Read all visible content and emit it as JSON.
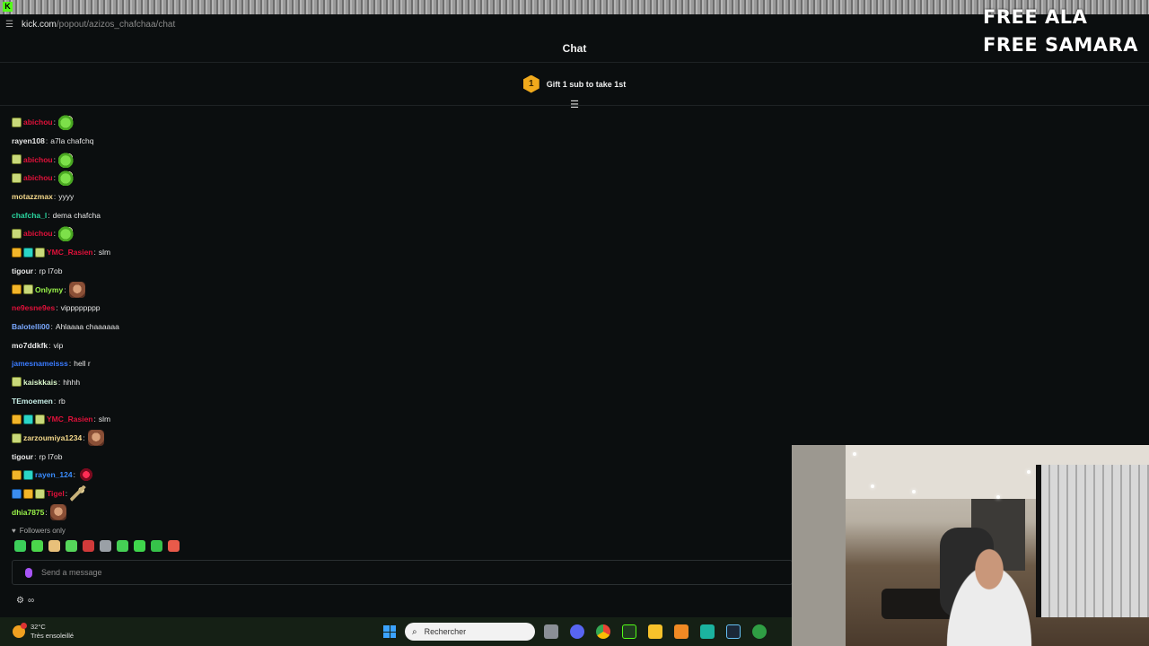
{
  "browser": {
    "url_host": "kick.com",
    "url_path": "/popout/azizos_chafchaa/chat"
  },
  "overlay": {
    "line1": "FREE ALA",
    "line2": "FREE SAMARA"
  },
  "chat": {
    "title": "Chat",
    "gift_rank": "1",
    "gift_text": "Gift 1 sub to take 1st",
    "followers_only": "Followers only",
    "input_placeholder": "Send a message",
    "messages": [
      {
        "badges": [
          "sub"
        ],
        "user": "abichou",
        "color": "#e0113a",
        "text": "",
        "emote": "green"
      },
      {
        "badges": [],
        "user": "rayen108",
        "color": "#e8e8e8",
        "text": "a7la chafchq",
        "emote": ""
      },
      {
        "badges": [
          "sub"
        ],
        "user": "abichou",
        "color": "#e0113a",
        "text": "",
        "emote": "green"
      },
      {
        "badges": [
          "sub"
        ],
        "user": "abichou",
        "color": "#e0113a",
        "text": "",
        "emote": "green"
      },
      {
        "badges": [],
        "user": "motazzmax",
        "color": "#f5d98b",
        "text": "yyyy",
        "emote": ""
      },
      {
        "badges": [],
        "user": "chafcha_l",
        "color": "#2ad6a0",
        "text": "dema chafcha",
        "emote": ""
      },
      {
        "badges": [
          "sub"
        ],
        "user": "abichou",
        "color": "#e0113a",
        "text": "",
        "emote": "green"
      },
      {
        "badges": [
          "crown",
          "vip",
          "sub"
        ],
        "user": "YMC_Rasien",
        "color": "#e0113a",
        "text": "slm",
        "emote": ""
      },
      {
        "badges": [],
        "user": "tigour",
        "color": "#e8e8e8",
        "text": "rp l7ob",
        "emote": ""
      },
      {
        "badges": [
          "crown",
          "sub"
        ],
        "user": "Onlymy",
        "color": "#9bf54a",
        "text": "",
        "emote": "face"
      },
      {
        "badges": [],
        "user": "ne9esne9es",
        "color": "#e0113a",
        "text": "vipppppppp",
        "emote": ""
      },
      {
        "badges": [],
        "user": "Balotelli00",
        "color": "#7aa8ff",
        "text": "Ahlaaaa chaaaaaa",
        "emote": ""
      },
      {
        "badges": [],
        "user": "mo7ddkfk",
        "color": "#e8e8e8",
        "text": "vip",
        "emote": ""
      },
      {
        "badges": [],
        "user": "jamesnameisss",
        "color": "#3a7bff",
        "text": "hell r",
        "emote": ""
      },
      {
        "badges": [
          "sub"
        ],
        "user": "kaiskkais",
        "color": "#d8f5c8",
        "text": "hhhh",
        "emote": ""
      },
      {
        "badges": [],
        "user": "TEmoemen",
        "color": "#c8f0e8",
        "text": "rb",
        "emote": ""
      },
      {
        "badges": [
          "crown",
          "vip",
          "sub"
        ],
        "user": "YMC_Rasien",
        "color": "#e0113a",
        "text": "slm",
        "emote": ""
      },
      {
        "badges": [
          "sub"
        ],
        "user": "zarzoumiya1234",
        "color": "#f5d98b",
        "text": "",
        "emote": "face"
      },
      {
        "badges": [],
        "user": "tigour",
        "color": "#e8e8e8",
        "text": "rp l7ob",
        "emote": ""
      },
      {
        "badges": [
          "crown",
          "vip"
        ],
        "user": "rayen_124",
        "color": "#3a8dff",
        "text": "",
        "emote": "red"
      },
      {
        "badges": [
          "blue",
          "crown",
          "sub"
        ],
        "user": "Tigel",
        "color": "#e0113a",
        "text": "",
        "emote": "tool"
      },
      {
        "badges": [],
        "user": "dhia7875",
        "color": "#9bf54a",
        "text": "",
        "emote": "face"
      }
    ]
  },
  "taskbar": {
    "temp": "32°C",
    "weather": "Très ensoleillé",
    "search_placeholder": "Rechercher"
  },
  "icons": {
    "pin": "pinned-messages-icon",
    "mic": "mic-icon",
    "emote_picker": "emote-icon",
    "settings": "settings-icon"
  },
  "colors": {
    "accent": "#53fc18",
    "background": "#0b0e0f",
    "gift_medal": "#f0a91c"
  }
}
